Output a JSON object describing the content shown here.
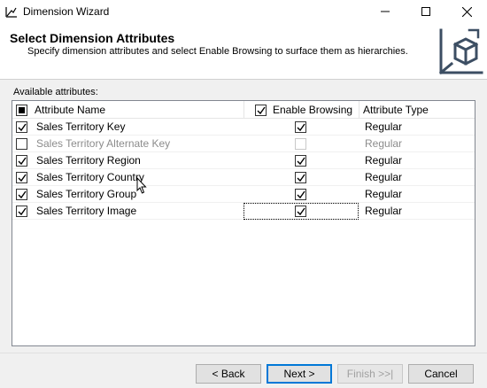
{
  "window": {
    "title": "Dimension Wizard"
  },
  "header": {
    "title": "Select Dimension Attributes",
    "subtitle": "Specify dimension attributes and select Enable Browsing to surface them as hierarchies.",
    "icon": "cube-axes-icon"
  },
  "available_label": "Available attributes:",
  "grid": {
    "columns": {
      "name": "Attribute Name",
      "browsing": "Enable Browsing",
      "type": "Attribute Type"
    },
    "rows": [
      {
        "name": "Sales Territory Key",
        "checked": true,
        "enabled": true,
        "browsing": true,
        "type": "Regular"
      },
      {
        "name": "Sales Territory Alternate Key",
        "checked": false,
        "enabled": false,
        "browsing": false,
        "type": "Regular"
      },
      {
        "name": "Sales Territory Region",
        "checked": true,
        "enabled": true,
        "browsing": true,
        "type": "Regular"
      },
      {
        "name": "Sales Territory Country",
        "checked": true,
        "enabled": true,
        "browsing": true,
        "type": "Regular"
      },
      {
        "name": "Sales Territory Group",
        "checked": true,
        "enabled": true,
        "browsing": true,
        "type": "Regular"
      },
      {
        "name": "Sales Territory Image",
        "checked": true,
        "enabled": true,
        "browsing": true,
        "type": "Regular"
      }
    ]
  },
  "buttons": {
    "back": "< Back",
    "next": "Next >",
    "finish": "Finish >>|",
    "cancel": "Cancel"
  },
  "colors": {
    "accent": "#0078d7",
    "disabled_text": "#8c8c8c"
  }
}
